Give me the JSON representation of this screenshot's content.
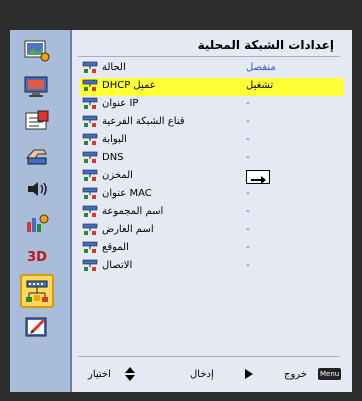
{
  "title": "إعدادات الشبكة المحلية",
  "rows": [
    {
      "label": "الحالة",
      "value": "منفصل"
    },
    {
      "label": "DHCP عميل",
      "value": "تشغيل"
    },
    {
      "label": "عنوان IP",
      "value": "-"
    },
    {
      "label": "قناع الشبكة الفرعية",
      "value": "-"
    },
    {
      "label": "البوابة",
      "value": "-"
    },
    {
      "label": "DNS",
      "value": "-"
    },
    {
      "label": "المخزن",
      "value": ""
    },
    {
      "label": "عنوان MAC",
      "value": "-"
    },
    {
      "label": "اسم المجموعة",
      "value": "-"
    },
    {
      "label": "اسم العارض",
      "value": "-"
    },
    {
      "label": "الموقع",
      "value": "-"
    },
    {
      "label": "الاتصال",
      "value": "-"
    }
  ],
  "footer": {
    "select_label": "اختيار",
    "enter_label": "إدخال",
    "exit_label": "خروج",
    "menu_label": "Menu"
  },
  "sidebar_icons": [
    "image-icon",
    "display-icon",
    "settings-icon",
    "volume-icon",
    "options-icon",
    "3d-icon",
    "network-icon",
    "edit-icon"
  ],
  "sidebar_3d_text": "3D",
  "selected_sidebar": "network-icon",
  "selected_row": 1,
  "colors": {
    "highlight": "#ffff38",
    "value_blue": "#2b56d6",
    "sidebar": "#a9bcd9",
    "panel": "#e4e9f3"
  }
}
